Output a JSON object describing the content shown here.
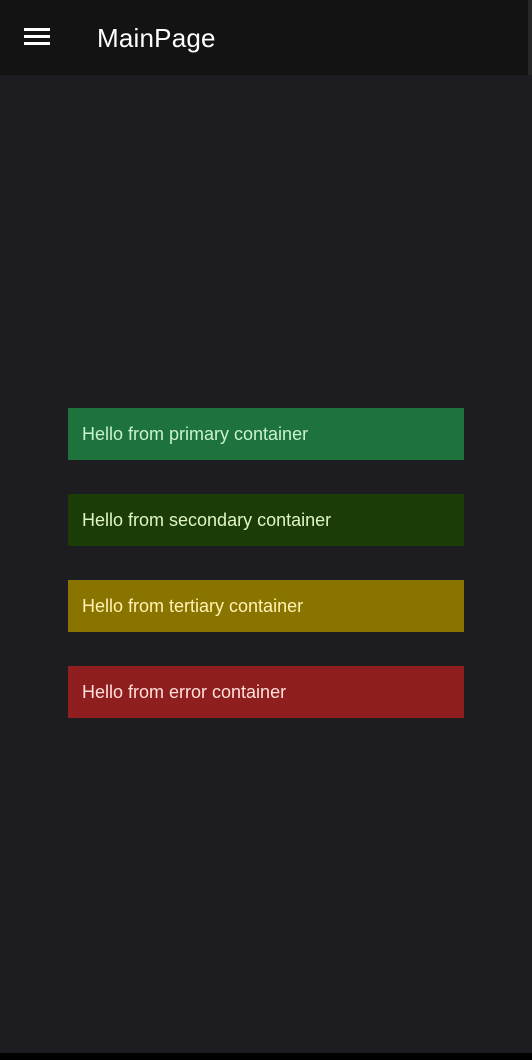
{
  "app_bar": {
    "title": "MainPage",
    "menu_icon": "hamburger-menu-icon"
  },
  "containers": [
    {
      "label": "Hello from primary container",
      "background": "#1e733d",
      "text_color": "#c9f2cf"
    },
    {
      "label": "Hello from secondary container",
      "background": "#1b3b07",
      "text_color": "#dff5c8"
    },
    {
      "label": "Hello from tertiary container",
      "background": "#8a7400",
      "text_color": "#fff2b3"
    },
    {
      "label": "Hello from error container",
      "background": "#8f1e1e",
      "text_color": "#ffe0dc"
    }
  ],
  "colors": {
    "app_bar_background": "#131313",
    "page_background": "#1d1c21"
  }
}
